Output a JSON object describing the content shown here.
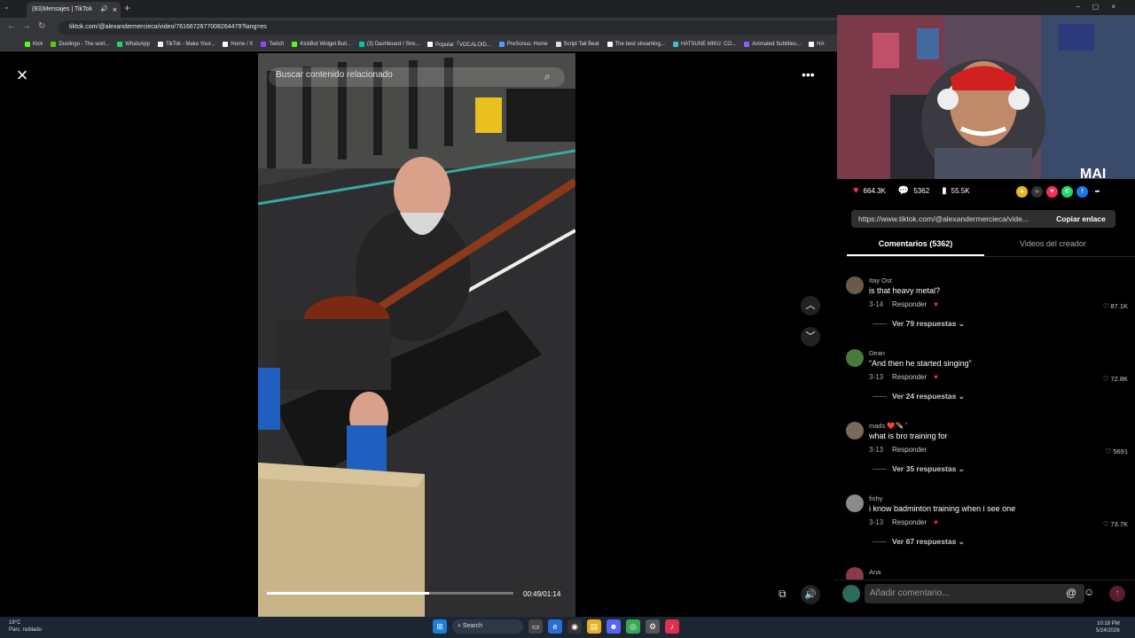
{
  "browser": {
    "tab_title": "(83)Mensajes | TikTok",
    "url": "tiktok.com/@alexandermercieca/video/7616672677008264479?lang=es",
    "bookmarks": [
      {
        "label": "Kick",
        "color": "#53fc18"
      },
      {
        "label": "Duolingo - The worl...",
        "color": "#58cc02"
      },
      {
        "label": "WhatsApp",
        "color": "#25d366"
      },
      {
        "label": "TikTok - Make Your...",
        "color": "#ffffff"
      },
      {
        "label": "Home / X",
        "color": "#ffffff"
      },
      {
        "label": "Twitch",
        "color": "#9146ff"
      },
      {
        "label": "KickBot Widget Buil...",
        "color": "#53fc18"
      },
      {
        "label": "(3) Dashboard / Stre...",
        "color": "#00c8a0"
      },
      {
        "label": "Popular「VOCALOID...",
        "color": "#ffffff"
      },
      {
        "label": "PreSonus: Home",
        "color": "#4a9eff"
      },
      {
        "label": "Script Tail Beat",
        "color": "#dddddd"
      },
      {
        "label": "The best streaming...",
        "color": "#ffffff"
      },
      {
        "label": "HATSUNE MIKU: CO...",
        "color": "#39c5bb"
      },
      {
        "label": "Animated Subtitles...",
        "color": "#8a5cff"
      },
      {
        "label": "HA",
        "color": "#ffffff"
      }
    ]
  },
  "video": {
    "search_placeholder": "Buscar contenido relacionado",
    "time": "00:49/01:14",
    "progress": 0.66
  },
  "webcam_label": "MAI",
  "stats": {
    "likes": "664.3K",
    "comments": "5362",
    "saves": "55.5K"
  },
  "share": {
    "link": "https://www.tiktok.com/@alexandermercieca/vide...",
    "copy_label": "Copiar enlace"
  },
  "tabs": {
    "comments": "Comentarios (5362)",
    "creator": "Videos del creador"
  },
  "comments": [
    {
      "user": "Itay Ost",
      "text": "is that heavy metal?",
      "date": "3-14",
      "reply": "Responder",
      "likes": "87.1K",
      "more": "Ver 79 respuestas",
      "avatar": "#6a5a4a"
    },
    {
      "user": "Dean",
      "text": "“And then he started singing”",
      "date": "3-13",
      "reply": "Responder",
      "likes": "72.8K",
      "more": "Ver 24 respuestas",
      "avatar": "#4a7a3a"
    },
    {
      "user": "mads ❤️🪶 ˚",
      "text": "what is bro training for",
      "date": "3-13",
      "reply": "Responder",
      "likes": "5691",
      "more": "Ver 35 respuestas",
      "avatar": "#7a6a5a"
    },
    {
      "user": "fishy",
      "text": "i know badminton training when i see one",
      "date": "3-13",
      "reply": "Responder",
      "likes": "73.7K",
      "more": "Ver 67 respuestas",
      "avatar": "#8a8a8a"
    }
  ],
  "partial_comment_user": "Ana",
  "comment_input_placeholder": "Añadir comentario...",
  "taskbar": {
    "weather_temp": "19°C",
    "weather_desc": "Parc. nublado",
    "search": "Search",
    "time": "10:18 PM",
    "date": "5/24/2026"
  }
}
